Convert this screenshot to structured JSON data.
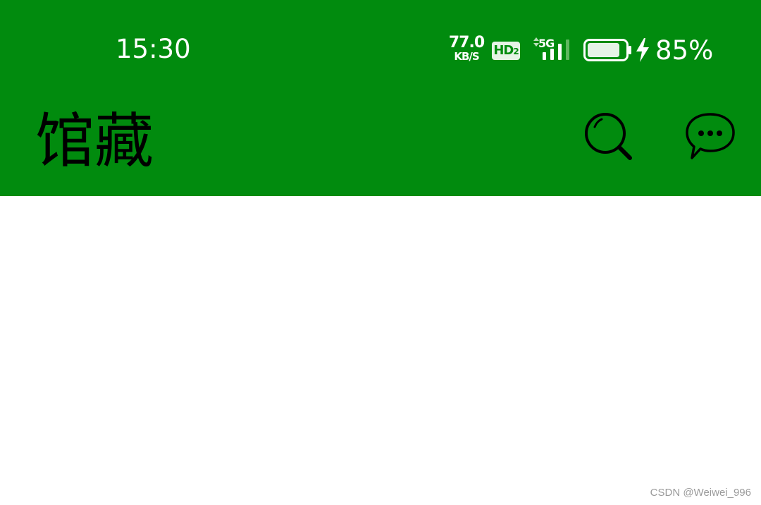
{
  "status_bar": {
    "time": "15:30",
    "net_speed_value": "77.0",
    "net_speed_unit": "KB/S",
    "hd_label": "HD",
    "hd_sub": "2",
    "network_type": "5G",
    "battery_percent": "85%",
    "battery_level": 0.85,
    "signal_icon": "signal-bars-icon",
    "battery_icon": "battery-icon",
    "charging_icon": "lightning-bolt-icon"
  },
  "app_bar": {
    "title": "馆藏",
    "background_color": "#018b0e",
    "search_icon": "search-icon",
    "message_icon": "chat-bubble-icon"
  },
  "watermark": "CSDN @Weiwei_996"
}
